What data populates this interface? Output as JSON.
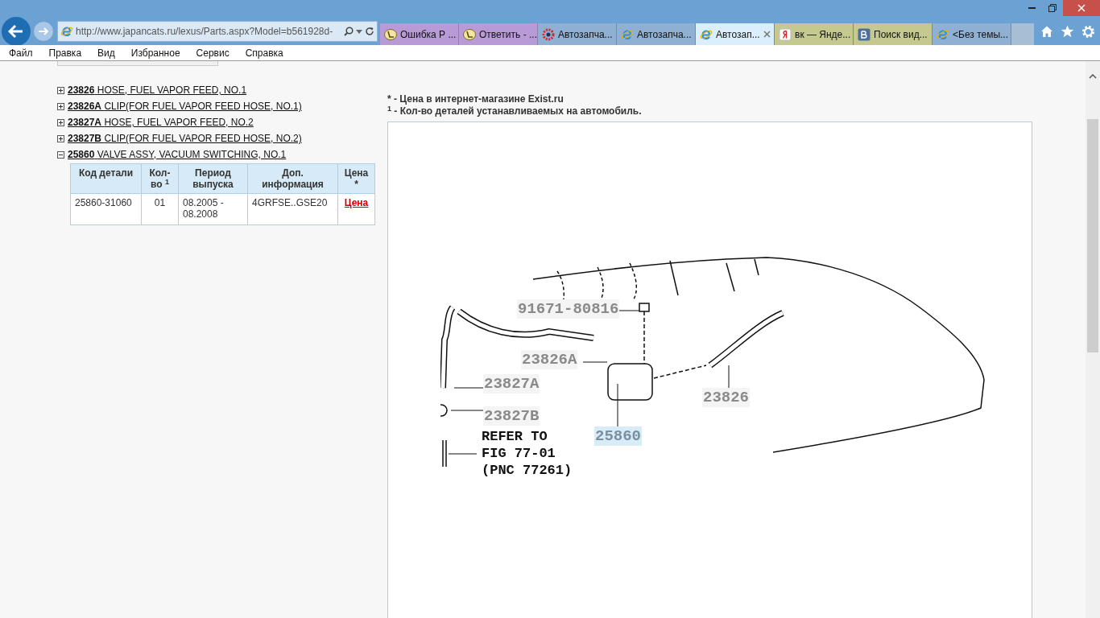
{
  "browser": {
    "address": "http://www.japancats.ru/lexus/Parts.aspx?Model=b561928d-",
    "tabs": [
      {
        "title": "Ошибка Р ...",
        "kind": "lexus",
        "selected": false
      },
      {
        "title": "Ответить - ...",
        "kind": "lexus",
        "selected": false
      },
      {
        "title": "Автозапча...",
        "kind": "gear",
        "selected": false
      },
      {
        "title": "Автозапча...",
        "kind": "ie",
        "selected": false
      },
      {
        "title": "Автозап...",
        "kind": "ie",
        "selected": true
      },
      {
        "title": "вк — Янде...",
        "kind": "yandex",
        "selected": false
      },
      {
        "title": "Поиск вид...",
        "kind": "vk",
        "selected": false
      },
      {
        "title": "<Без темы...",
        "kind": "ie",
        "selected": false
      }
    ],
    "menu": [
      "Файл",
      "Правка",
      "Вид",
      "Избранное",
      "Сервис",
      "Справка"
    ]
  },
  "parts": [
    {
      "code": "23826",
      "name": "HOSE, FUEL VAPOR FEED, NO.1",
      "expanded": false
    },
    {
      "code": "23826A",
      "name": "CLIP(FOR FUEL VAPOR FEED HOSE, NO.1)",
      "expanded": false
    },
    {
      "code": "23827A",
      "name": "HOSE, FUEL VAPOR FEED, NO.2",
      "expanded": false
    },
    {
      "code": "23827B",
      "name": "CLIP(FOR FUEL VAPOR FEED HOSE, NO.2)",
      "expanded": false
    },
    {
      "code": "25860",
      "name": "VALVE ASSY, VACUUM SWITCHING, NO.1",
      "expanded": true
    }
  ],
  "table": {
    "columns": [
      "Код детали",
      "Кол-во $^{1}$",
      "Период выпуска",
      "Доп. информация",
      "Цена *"
    ],
    "rows": [
      [
        "25860-31060",
        "01",
        "08.2005 - 08.2008",
        "4GRFSE..GSE20",
        "Цена"
      ]
    ]
  },
  "notes": [
    "* - Цена в интернет-магазине Exist.ru",
    "$^{1}$ - Кол-во деталей устанавливаемых на автомобиль."
  ],
  "diagram": {
    "labels": [
      {
        "text": "91671-80816",
        "highlighted": false
      },
      {
        "text": "23826A",
        "highlighted": false
      },
      {
        "text": "23827A",
        "highlighted": false
      },
      {
        "text": "23827B",
        "highlighted": false
      },
      {
        "text": "23826",
        "highlighted": false
      },
      {
        "text": "25860",
        "highlighted": true
      }
    ],
    "reference": [
      "REFER TO",
      "FIG 77-01",
      "(PNC 77261)"
    ]
  }
}
